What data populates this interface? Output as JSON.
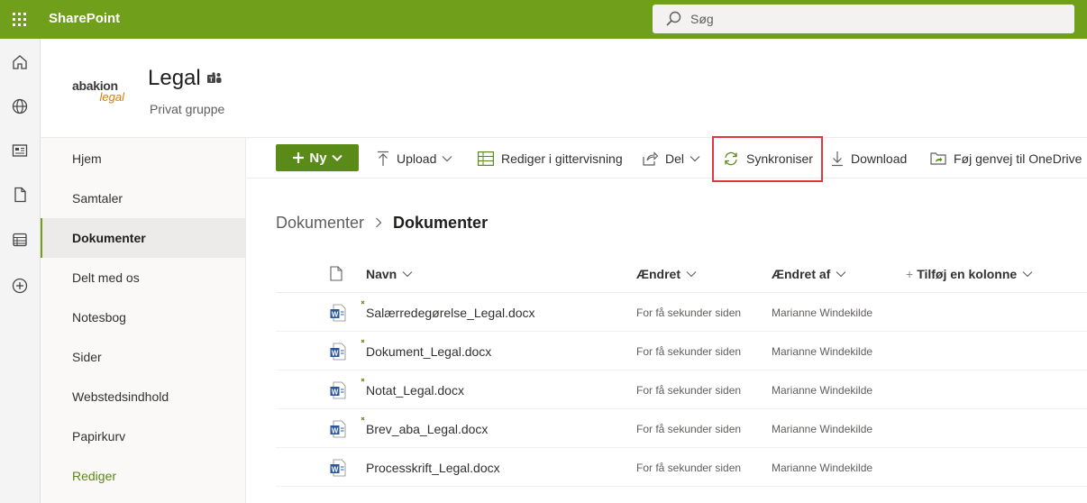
{
  "suite_bar": {
    "brand": "SharePoint",
    "search_placeholder": "Søg",
    "color": "#6f9f1b"
  },
  "app_rail": {
    "icons": [
      "home-icon",
      "globe-icon",
      "news-icon",
      "file-icon",
      "list-icon",
      "add-icon"
    ]
  },
  "site": {
    "logo_text_top": "abakion",
    "logo_text_bottom": "legal",
    "title": "Legal",
    "subtitle": "Privat gruppe"
  },
  "left_nav": {
    "items": [
      {
        "label": "Hjem"
      },
      {
        "label": "Samtaler"
      },
      {
        "label": "Dokumenter"
      },
      {
        "label": "Delt med os"
      },
      {
        "label": "Notesbog"
      },
      {
        "label": "Sider"
      },
      {
        "label": "Webstedsindhold"
      },
      {
        "label": "Papirkurv"
      },
      {
        "label": "Rediger"
      }
    ],
    "active": "Dokumenter"
  },
  "command_bar": {
    "new_label": "Ny",
    "upload_label": "Upload",
    "grid_label": "Rediger i gittervisning",
    "share_label": "Del",
    "sync_label": "Synkroniser",
    "download_label": "Download",
    "shortcut_label": "Føj genvej til OneDrive",
    "accent": "#5a8a17",
    "highlight_color": "#e0383e"
  },
  "breadcrumb": {
    "parent": "Dokumenter",
    "current": "Dokumenter"
  },
  "list": {
    "columns": {
      "name": "Navn",
      "modified": "Ændret",
      "modified_by": "Ændret af",
      "add_column": "Tilføj en kolonne"
    },
    "rows": [
      {
        "name": "Salærredegørelse_Legal.docx",
        "modified": "For få sekunder siden",
        "modified_by": "Marianne Windekilde",
        "new": true
      },
      {
        "name": "Dokument_Legal.docx",
        "modified": "For få sekunder siden",
        "modified_by": "Marianne Windekilde",
        "new": true
      },
      {
        "name": "Notat_Legal.docx",
        "modified": "For få sekunder siden",
        "modified_by": "Marianne Windekilde",
        "new": true
      },
      {
        "name": "Brev_aba_Legal.docx",
        "modified": "For få sekunder siden",
        "modified_by": "Marianne Windekilde",
        "new": true
      },
      {
        "name": "Processkrift_Legal.docx",
        "modified": "For få sekunder siden",
        "modified_by": "Marianne Windekilde",
        "new": false
      }
    ]
  }
}
